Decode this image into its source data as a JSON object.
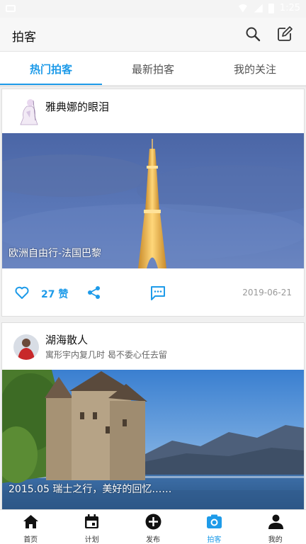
{
  "status_bar": {
    "time": "1:25"
  },
  "app_bar": {
    "title": "拍客",
    "search_icon": "search-icon",
    "edit_icon": "edit-icon"
  },
  "tabs": [
    {
      "label": "热门拍客",
      "active": true
    },
    {
      "label": "最新拍客",
      "active": false
    },
    {
      "label": "我的关注",
      "active": false
    }
  ],
  "posts": [
    {
      "author": "雅典娜的眼泪",
      "bio": "",
      "caption": "欧洲自由行-法国巴黎",
      "likes": "27 赞",
      "date": "2019-06-21"
    },
    {
      "author": "湖海散人",
      "bio": "寓形宇内复几时 曷不委心任去留",
      "caption": "2015.05 瑞士之行，美好的回忆……"
    }
  ],
  "bottom_nav": [
    {
      "label": "首页",
      "icon": "home-icon",
      "active": false
    },
    {
      "label": "计划",
      "icon": "calendar-icon",
      "active": false
    },
    {
      "label": "发布",
      "icon": "add-icon",
      "active": false
    },
    {
      "label": "拍客",
      "icon": "camera-icon",
      "active": true
    },
    {
      "label": "我的",
      "icon": "person-icon",
      "active": false
    }
  ],
  "colors": {
    "accent": "#1e9be9",
    "text": "#111111",
    "muted": "#999999"
  }
}
